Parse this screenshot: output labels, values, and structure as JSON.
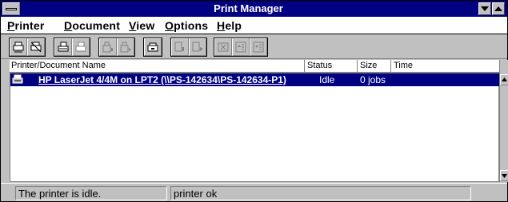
{
  "window": {
    "title": "Print Manager"
  },
  "menu": {
    "items": [
      {
        "label": "Printer",
        "accel": "P",
        "rest": "rinter"
      },
      {
        "label": "Document",
        "accel": "D",
        "rest": "ocument"
      },
      {
        "label": "View",
        "accel": "V",
        "rest": "iew"
      },
      {
        "label": "Options",
        "accel": "O",
        "rest": "ptions"
      },
      {
        "label": "Help",
        "accel": "H",
        "rest": "elp"
      }
    ]
  },
  "toolbar": {
    "buttons": [
      {
        "icon": "connect-printer-icon"
      },
      {
        "icon": "disconnect-printer-icon"
      },
      {
        "icon": "printer-properties-icon"
      },
      {
        "icon": "share-printer-icon"
      },
      {
        "icon": "pause-printer-icon"
      },
      {
        "icon": "resume-printer-icon"
      },
      {
        "icon": "set-default-printer-icon"
      },
      {
        "icon": "pause-document-icon"
      },
      {
        "icon": "resume-document-icon"
      },
      {
        "icon": "delete-document-icon"
      },
      {
        "icon": "move-document-up-icon"
      },
      {
        "icon": "move-document-down-icon"
      }
    ]
  },
  "list": {
    "columns": {
      "name": "Printer/Document Name",
      "status": "Status",
      "size": "Size",
      "time": "Time"
    },
    "rows": [
      {
        "icon": "printer-icon",
        "name": "HP LaserJet 4/4M on LPT2 (\\\\PS-142634\\PS-142634-P1)",
        "status": "Idle",
        "size": "0 jobs",
        "time": ""
      }
    ]
  },
  "status": {
    "message": "The printer is idle.",
    "detail": "printer ok"
  },
  "colors": {
    "titlebar": "#000080",
    "selection": "#000080",
    "face": "#c0c0c0"
  }
}
